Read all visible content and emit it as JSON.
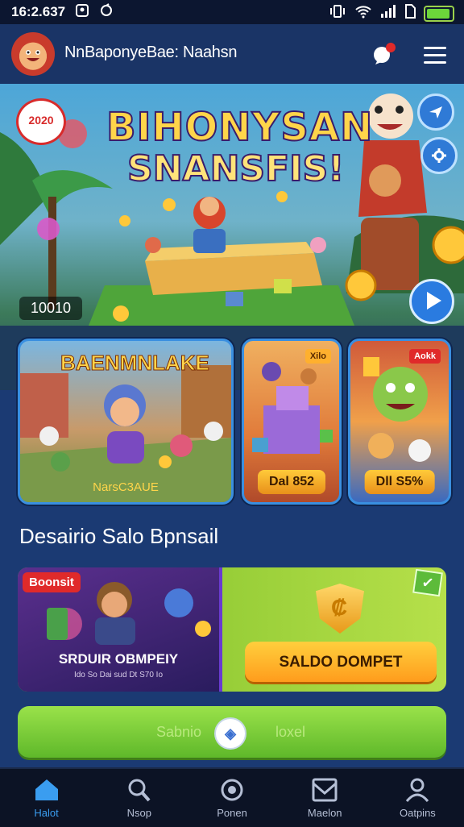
{
  "status_bar": {
    "time": "16:2.637"
  },
  "header": {
    "title": "NnBaponyeBae: Naahsn"
  },
  "hero": {
    "title_line1": "BIHONYSAN",
    "title_line2": "SNANSFIS!",
    "badge_text": "2020",
    "counter": "10010"
  },
  "games": [
    {
      "title": "BAENMNLAKE",
      "caption": "NarsC3AUE"
    },
    {
      "tag": "Xilo",
      "label": "Dal 852"
    },
    {
      "tag": "Aokk",
      "label": "Dll S5%"
    }
  ],
  "section": {
    "title": "Desairio Salo Bpnsail"
  },
  "bonus": {
    "tag": "Boonsit",
    "left_title": "SRDUIR OBMPEIY",
    "left_sub": "Ido So Dai sud Dt S70 Io",
    "button_label": "SALDO DOMPET"
  },
  "action": {
    "left_label": "Sabnio",
    "right_label": "loxel"
  },
  "nav": {
    "items": [
      {
        "label": "Halot",
        "icon": "home-icon"
      },
      {
        "label": "Nsop",
        "icon": "search-icon"
      },
      {
        "label": "Ponen",
        "icon": "camera-icon"
      },
      {
        "label": "Maelon",
        "icon": "message-icon"
      },
      {
        "label": "Oatpins",
        "icon": "profile-icon"
      }
    ]
  },
  "colors": {
    "accent": "#3a9df0",
    "primary_bg": "#1b3a73",
    "button_orange": "#ffb02e",
    "button_green": "#7fd43a"
  }
}
